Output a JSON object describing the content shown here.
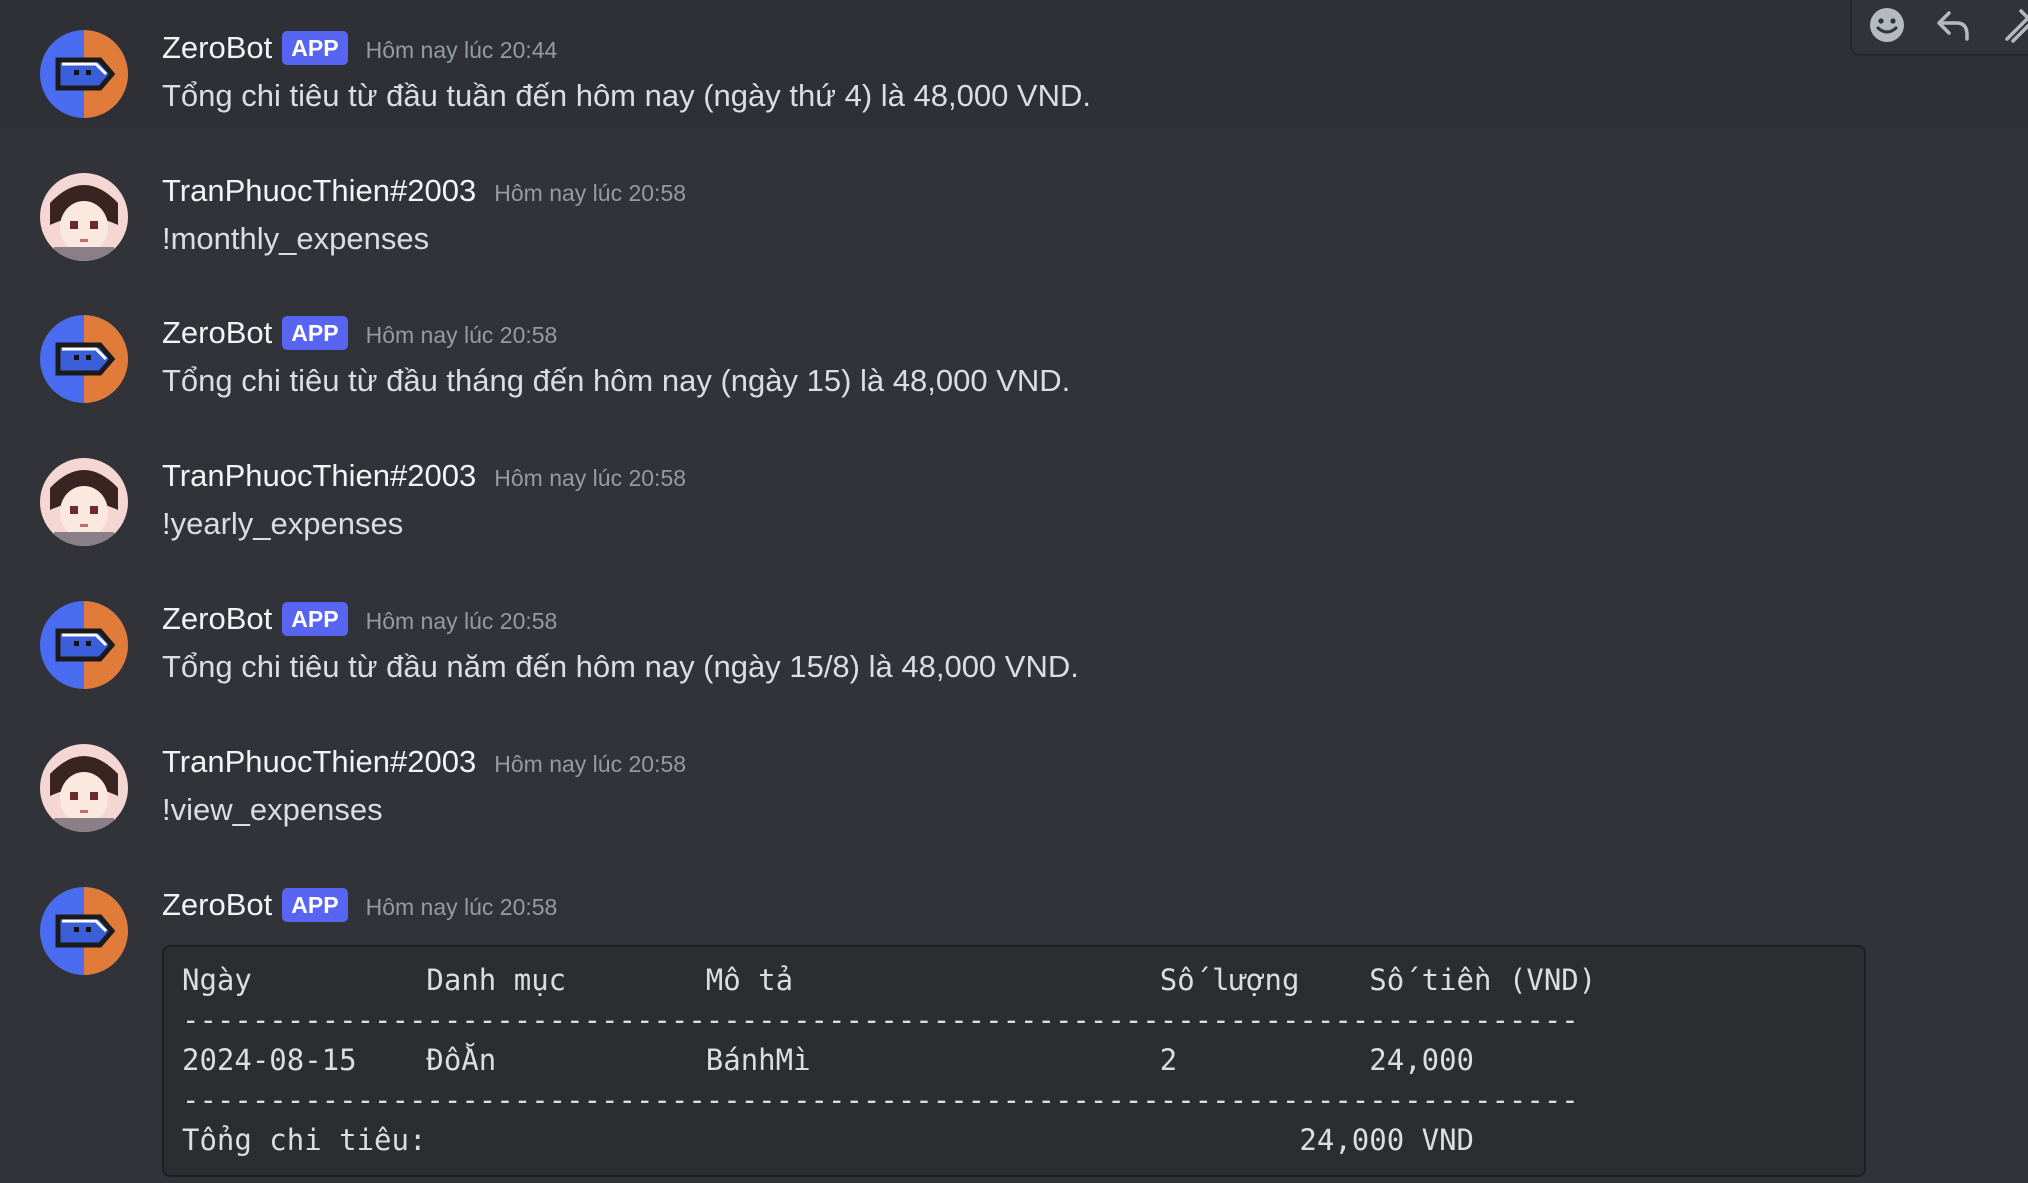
{
  "bot_name": "ZeroBot",
  "bot_badge": "APP",
  "user_name": "TranPhuocThien#2003",
  "messages": [
    {
      "author": "ZeroBot",
      "timestamp": "Hôm nay lúc 20:44",
      "text": "Tổng chi tiêu từ đầu tuần đến hôm nay (ngày thứ 4) là 48,000 VND."
    },
    {
      "author": "TranPhuocThien#2003",
      "timestamp": "Hôm nay lúc 20:58",
      "text": "!monthly_expenses"
    },
    {
      "author": "ZeroBot",
      "timestamp": "Hôm nay lúc 20:58",
      "text": "Tổng chi tiêu từ đầu tháng đến hôm nay (ngày 15) là 48,000 VND."
    },
    {
      "author": "TranPhuocThien#2003",
      "timestamp": "Hôm nay lúc 20:58",
      "text": "!yearly_expenses"
    },
    {
      "author": "ZeroBot",
      "timestamp": "Hôm nay lúc 20:58",
      "text": "Tổng chi tiêu từ đầu năm đến hôm nay (ngày 15/8) là 48,000 VND."
    },
    {
      "author": "TranPhuocThien#2003",
      "timestamp": "Hôm nay lúc 20:58",
      "text": "!view_expenses"
    },
    {
      "author": "ZeroBot",
      "timestamp": "Hôm nay lúc 20:58",
      "text": ""
    }
  ],
  "expense_table": {
    "header": "Ngày          Danh mục        Mô tả                     Số lượng    Số tiền (VND)",
    "separator": "--------------------------------------------------------------------------------",
    "row": "2024-08-15    ĐồĂn            BánhMì                    2           24,000",
    "separator2": "--------------------------------------------------------------------------------",
    "total": "Tổng chi tiêu:                                                  24,000 VND"
  },
  "toolbar": {
    "icons": [
      "emoji-icon",
      "reply-icon",
      "more-icon"
    ]
  }
}
